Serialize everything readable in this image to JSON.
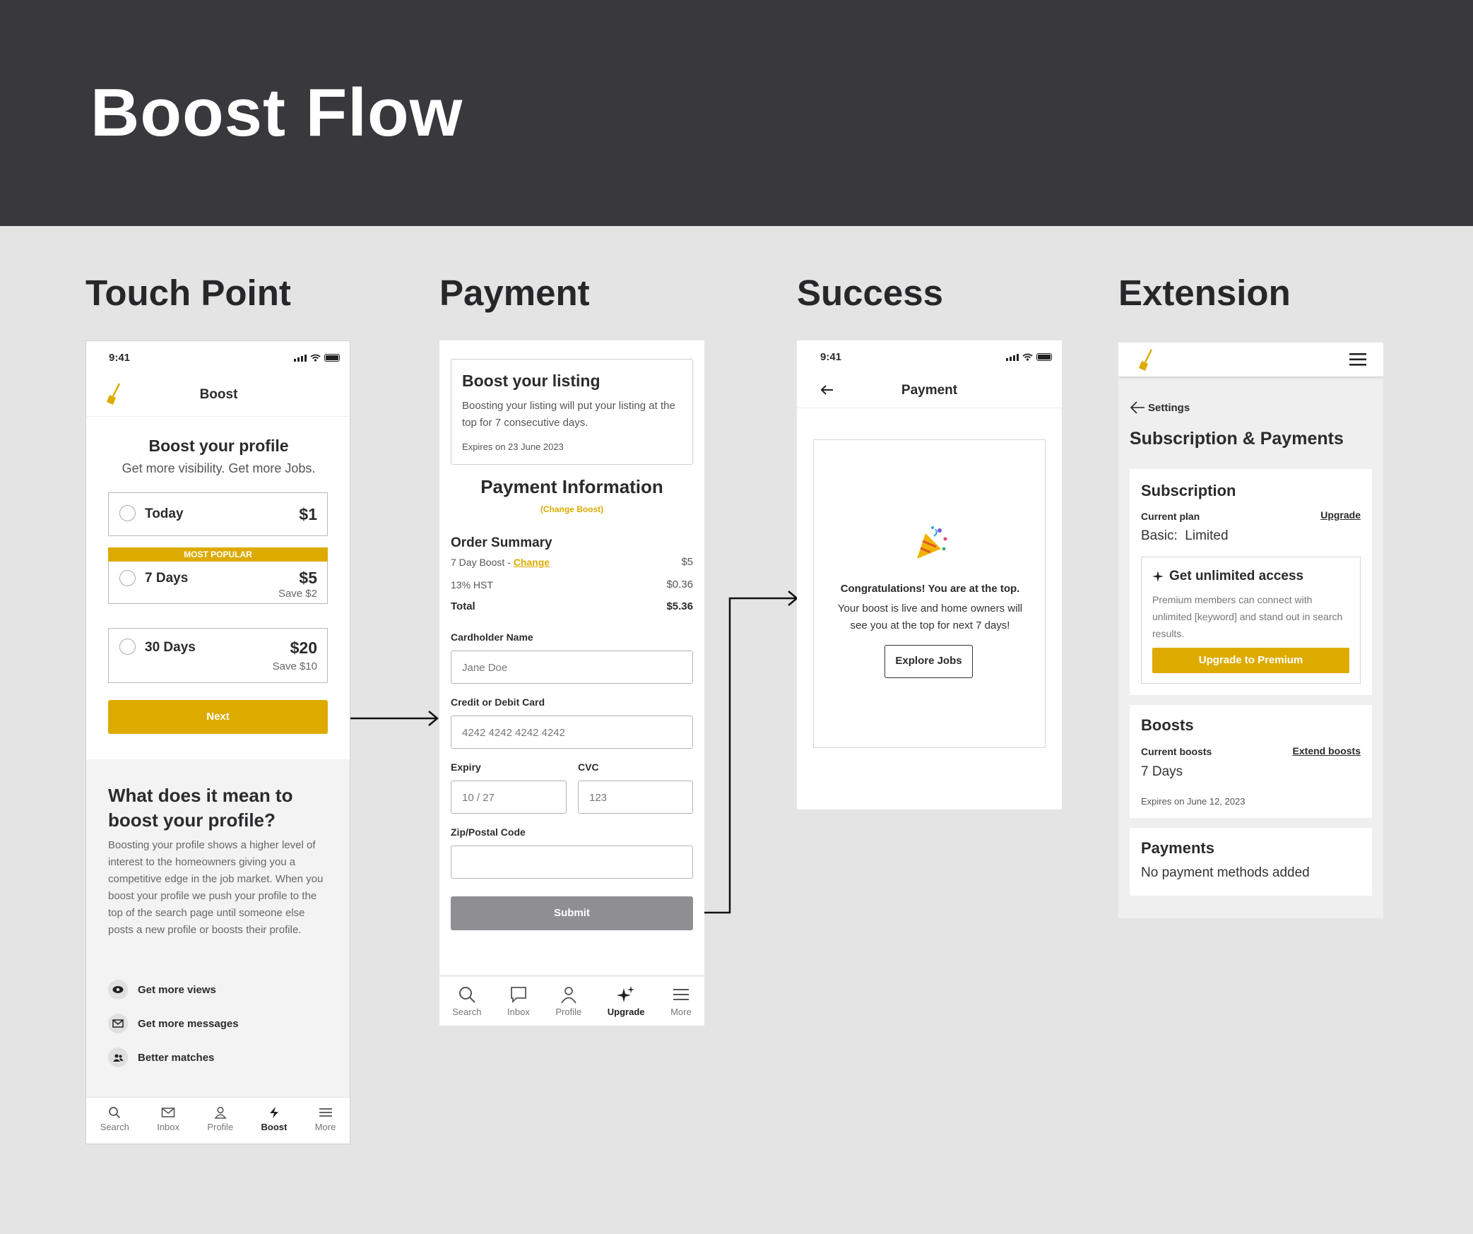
{
  "page": {
    "title": "Boost Flow"
  },
  "columns": {
    "touch": "Touch Point",
    "payment": "Payment",
    "success": "Success",
    "extension": "Extension"
  },
  "status": {
    "time": "9:41"
  },
  "touch": {
    "header_title": "Boost",
    "heading": "Boost your profile",
    "subheading": "Get more visibility. Get more Jobs.",
    "options": [
      {
        "label": "Today",
        "price": "$1",
        "save": ""
      },
      {
        "label": "7 Days",
        "price": "$5",
        "save": "Save $2",
        "badge": "MOST POPULAR"
      },
      {
        "label": "30 Days",
        "price": "$20",
        "save": "Save $10"
      }
    ],
    "next_label": "Next",
    "info_title": "What does it mean to boost your profile?",
    "info_body": "Boosting your profile shows a higher level of interest to the homeowners giving you a competitive edge in the job market. When you boost your profile we push your profile to the top of the search page until someone else posts a new profile or boosts their profile.",
    "features": [
      "Get more views",
      "Get more messages",
      "Better matches"
    ],
    "nav": [
      "Search",
      "Inbox",
      "Profile",
      "Boost",
      "More"
    ]
  },
  "payment": {
    "card_title": "Boost your listing",
    "card_body": "Boosting your listing will put your listing at the top for 7 consecutive days.",
    "card_expiry": "Expires on 23 June 2023",
    "info_title": "Payment Information",
    "change_boost": "(Change Boost)",
    "order_title": "Order Summary",
    "item_label": "7 Day Boost - ",
    "item_change": "Change",
    "item_price": "$5",
    "tax_label": "13% HST",
    "tax_value": "$0.36",
    "total_label": "Total",
    "total_value": "$5.36",
    "cardholder_label": "Cardholder Name",
    "cardholder_placeholder": "Jane Doe",
    "card_label": "Credit or Debit Card",
    "card_placeholder": "4242 4242 4242 4242",
    "expiry_label": "Expiry",
    "expiry_placeholder": "10 / 27",
    "cvc_label": "CVC",
    "cvc_placeholder": "123",
    "zip_label": "Zip/Postal Code",
    "zip_placeholder": "",
    "submit_label": "Submit",
    "nav": [
      "Search",
      "Inbox",
      "Profile",
      "Upgrade",
      "More"
    ]
  },
  "success": {
    "header_title": "Payment",
    "headline": "Congratulations! You are at the top.",
    "body": "Your boost is live and home owners will see you at the top for next 7 days!",
    "button": "Explore Jobs"
  },
  "extension": {
    "back_label": "Settings",
    "title": "Subscription & Payments",
    "subscription_title": "Subscription",
    "current_plan_label": "Current plan",
    "upgrade_link": "Upgrade",
    "plan_value": "Basic:  Limited",
    "promo_title": "Get unlimited access",
    "promo_body": "Premium members can connect with unlimited [keyword] and stand out in search results.",
    "promo_button": "Upgrade to Premium",
    "boosts_title": "Boosts",
    "current_boosts_label": "Current boosts",
    "extend_link": "Extend boosts",
    "boosts_value": "7 Days",
    "boosts_expiry": "Expires on June 12, 2023",
    "payments_title": "Payments",
    "payments_value": "No payment methods added"
  },
  "colors": {
    "accent": "#ddab00",
    "header_bg": "#39383d",
    "canvas": "#e4e4e4",
    "disabled": "#8e8e93"
  }
}
